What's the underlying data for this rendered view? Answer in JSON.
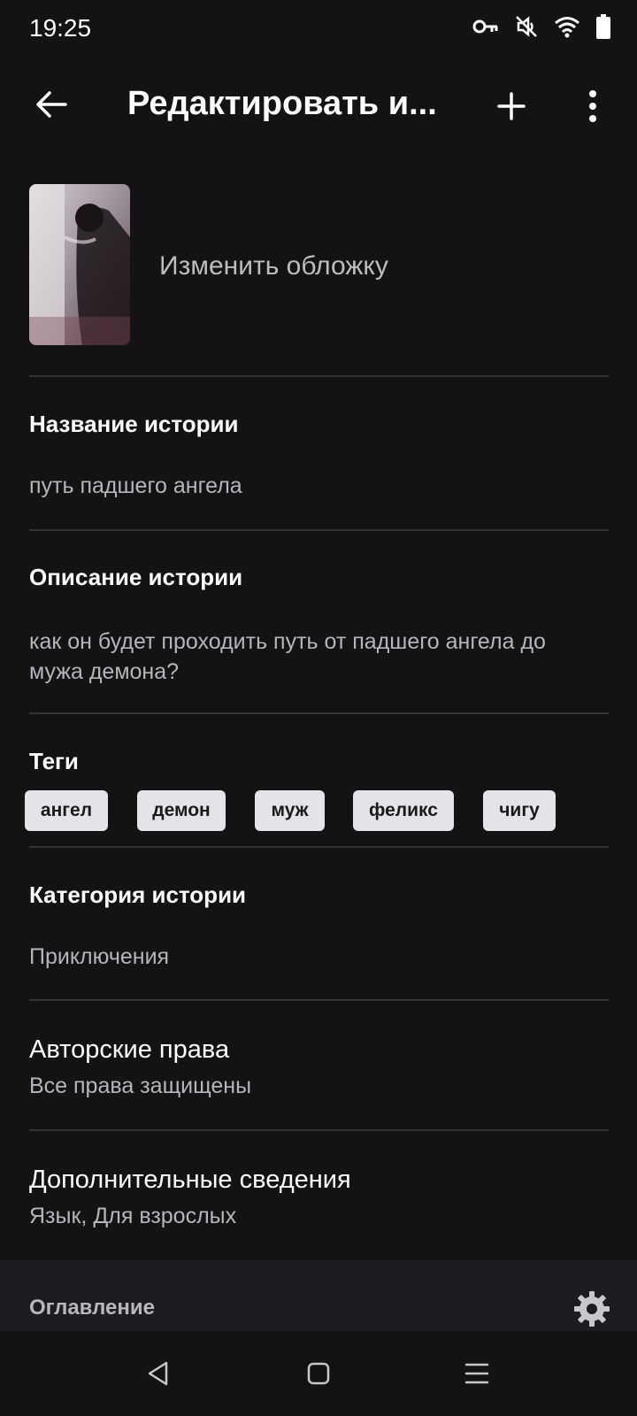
{
  "status": {
    "time": "19:25"
  },
  "appbar": {
    "title": "Редактировать и..."
  },
  "cover": {
    "label": "Изменить обложку"
  },
  "story_title": {
    "label": "Название истории",
    "value": "путь падшего ангела"
  },
  "story_description": {
    "label": "Описание истории",
    "value": "как он будет проходить путь от падшего ангела до мужа демона?"
  },
  "tags": {
    "label": "Теги",
    "items": [
      "ангел",
      "демон",
      "муж",
      "феликс",
      "чигу"
    ]
  },
  "category": {
    "label": "Категория истории",
    "value": "Приключения"
  },
  "copyright": {
    "label": "Авторские права",
    "value": "Все права защищены"
  },
  "details": {
    "label": "Дополнительные сведения",
    "value": "Язык, Для взрослых"
  },
  "toc": {
    "label": "Оглавление"
  },
  "colors": {
    "background": "#141215",
    "tag_bg": "#e5e3e7",
    "muted_text": "#b7b5b9"
  }
}
